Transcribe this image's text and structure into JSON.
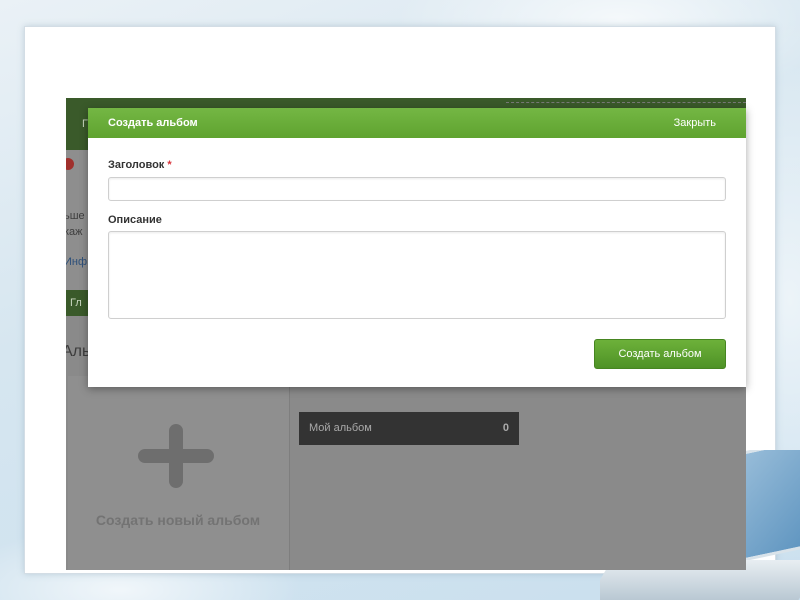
{
  "background_page": {
    "topbar_fragment": "Г",
    "text_fragments": [
      "ьше",
      "каж"
    ],
    "link_fragment": "Инф",
    "greenbar_fragment": "Гл",
    "heading_fragment": "Аль",
    "create_new_album_label": "Создать новый альбом",
    "album_item": {
      "name": "Мой альбом",
      "count": "0"
    }
  },
  "modal": {
    "title": "Создать альбом",
    "close_label": "Закрыть",
    "title_field": {
      "label": "Заголовок",
      "required_mark": "*",
      "value": "",
      "placeholder": ""
    },
    "description_field": {
      "label": "Описание",
      "value": "",
      "placeholder": ""
    },
    "submit_label": "Создать альбом"
  },
  "colors": {
    "accent_green": "#62a533",
    "required_star": "#d8333a",
    "overlay_gray": "#8a8a8a"
  }
}
